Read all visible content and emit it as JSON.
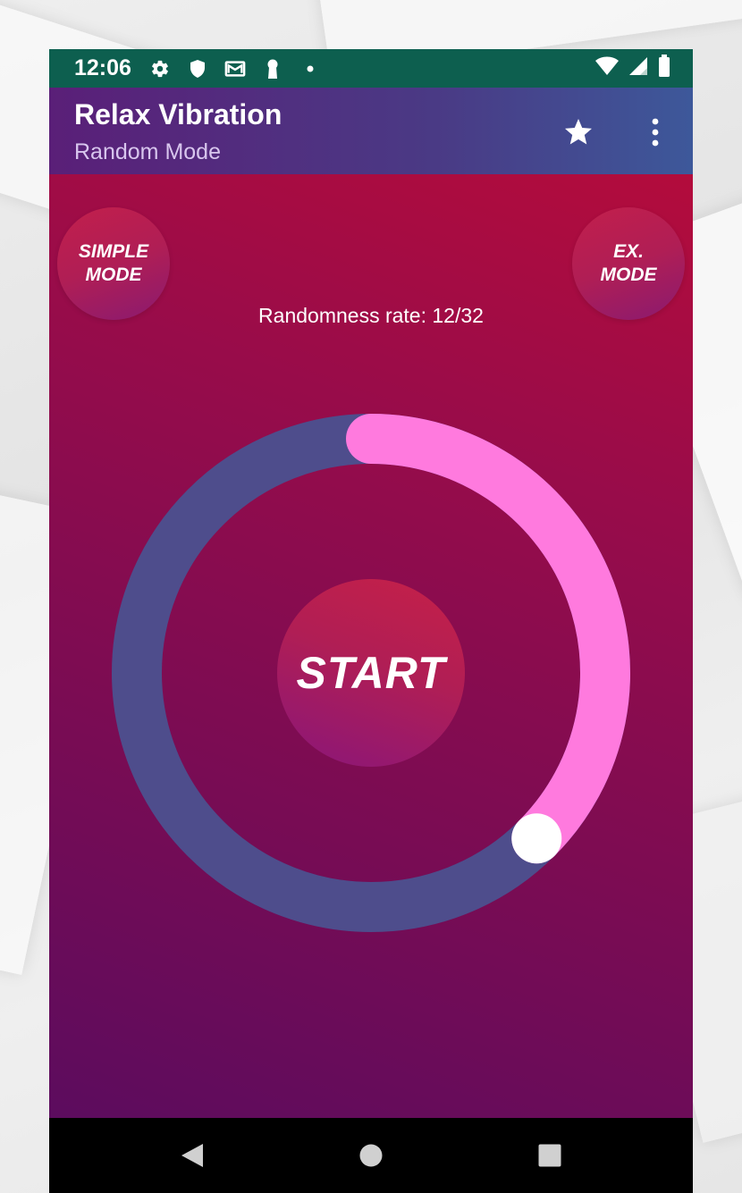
{
  "status_bar": {
    "time": "12:06",
    "left_icons": [
      "gear-icon",
      "shield-icon",
      "mail-icon",
      "keyhole-icon",
      "dot-icon"
    ],
    "right_icons": [
      "wifi-icon",
      "signal-icon",
      "battery-icon"
    ],
    "color": "#0d5f4f"
  },
  "app_bar": {
    "title": "Relax Vibration",
    "subtitle": "Random Mode",
    "actions": [
      "star-icon",
      "more-vert-icon"
    ]
  },
  "modes": {
    "simple_line1": "SIMPLE",
    "simple_line2": "MODE",
    "ex_line1": "EX.",
    "ex_line2": "MODE"
  },
  "randomness": {
    "label": "Randomness rate: 12/32",
    "value": 12,
    "max": 32
  },
  "start_label": "START",
  "colors": {
    "track": "#4e4d8c",
    "progress": "#ff7ade",
    "knob": "#ffffff",
    "background_top": "#b30c3c",
    "background_bottom": "#5c0c5e"
  },
  "nav_bar": {
    "icons": [
      "back-icon",
      "home-icon",
      "recents-icon"
    ]
  }
}
